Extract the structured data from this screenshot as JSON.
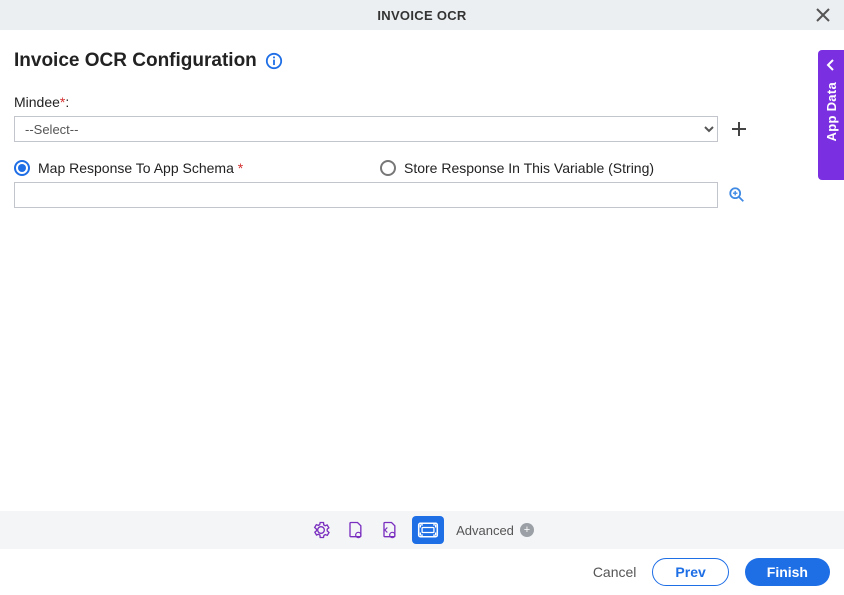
{
  "header": {
    "title": "INVOICE OCR"
  },
  "page": {
    "title": "Invoice OCR Configuration"
  },
  "fields": {
    "mindee": {
      "label": "Mindee",
      "select_placeholder": "--Select--"
    },
    "radio1_label": "Map Response To App Schema",
    "radio2_label": "Store Response In This Variable (String)",
    "mapping_value": ""
  },
  "toolbar": {
    "advanced_label": "Advanced"
  },
  "footer": {
    "cancel": "Cancel",
    "prev": "Prev",
    "finish": "Finish"
  },
  "side_tab": {
    "label": "App Data"
  }
}
